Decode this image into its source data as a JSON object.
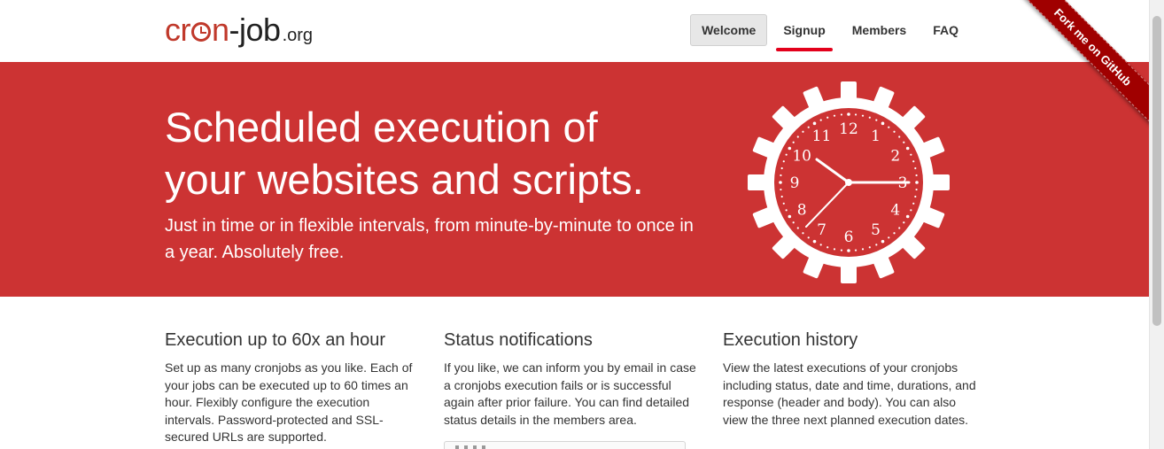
{
  "header": {
    "logo": {
      "cron_prefix": "cr",
      "cron_suffix": "n",
      "job": "-job",
      "org": ".org"
    },
    "nav": [
      {
        "label": "Welcome",
        "active": true
      },
      {
        "label": "Signup",
        "active": false,
        "highlighted": true
      },
      {
        "label": "Members",
        "active": false
      },
      {
        "label": "FAQ",
        "active": false
      }
    ],
    "ribbon": "Fork me on GitHub"
  },
  "hero": {
    "title_line1": "Scheduled execution of",
    "title_line2": "your websites and scripts.",
    "subtitle": "Just in time or in flexible intervals, from minute-by-minute to once in a year. Absolutely free.",
    "clock_numbers": [
      "12",
      "1",
      "2",
      "3",
      "4",
      "5",
      "6",
      "7",
      "8",
      "9",
      "10",
      "11"
    ],
    "clock_icon": "gear-clock-icon"
  },
  "features": [
    {
      "title": "Execution up to 60x an hour",
      "text": "Set up as many cronjobs as you like. Each of your jobs can be executed up to 60 times an hour. Flexibly configure the execution intervals. Password-protected and SSL-secured URLs are supported."
    },
    {
      "title": "Status notifications",
      "text": "If you like, we can inform you by email in case a cronjobs execution fails or is successful again after prior failure. You can find detailed status details in the members area."
    },
    {
      "title": "Execution history",
      "text": "View the latest executions of your cronjobs including status, date and time, durations, and response (header and body). You can also view the three next planned execution dates."
    }
  ],
  "colors": {
    "brand_red": "#cc3333",
    "logo_red": "#c0392b",
    "ribbon_red": "#a00000",
    "signup_underline": "#e3001b"
  }
}
